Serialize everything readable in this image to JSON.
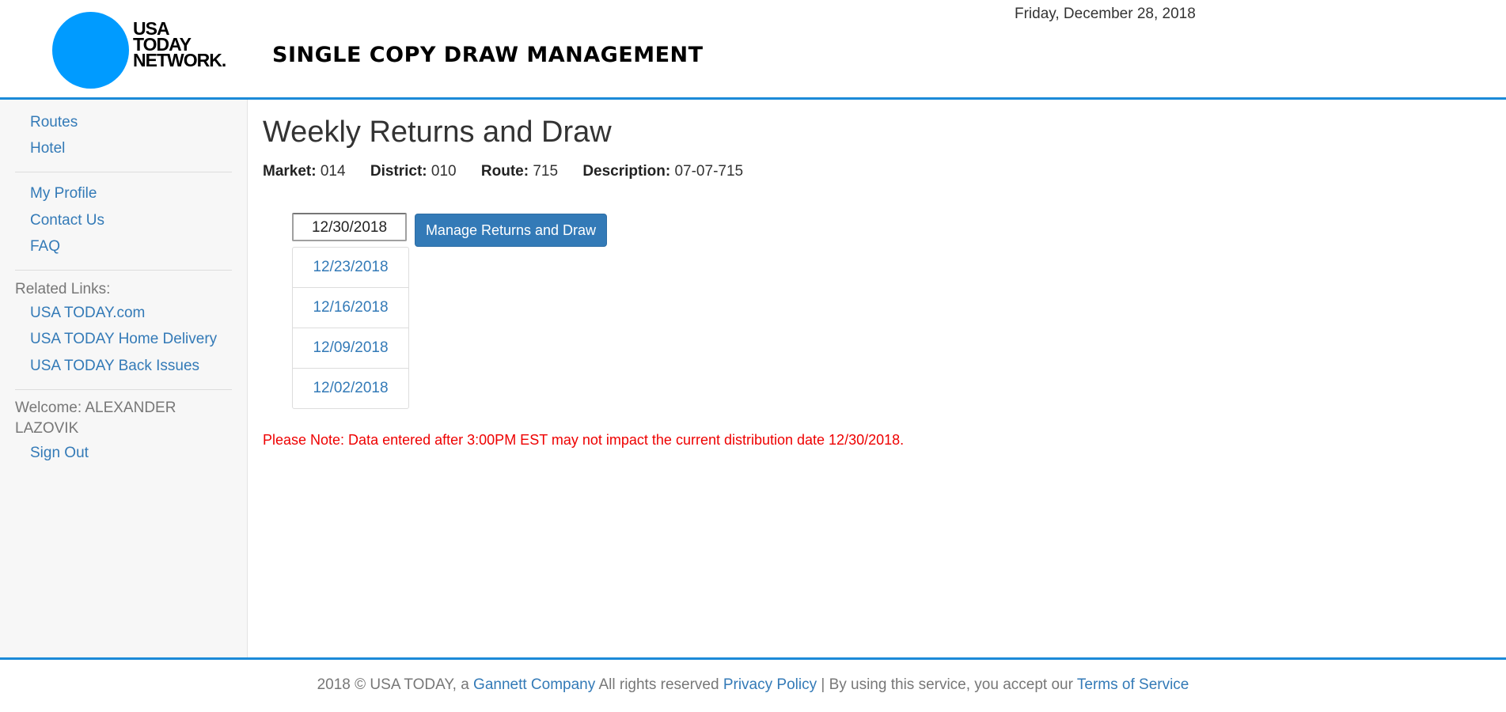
{
  "header": {
    "logo_lines": [
      "USA",
      "TODAY",
      "NETWORK."
    ],
    "app_title": "SINGLE COPY DRAW MANAGEMENT",
    "date": "Friday, December 28, 2018",
    "brand_color": "#009bff"
  },
  "sidebar": {
    "nav": [
      {
        "label": "Routes"
      },
      {
        "label": "Hotel"
      }
    ],
    "account": [
      {
        "label": "My Profile"
      },
      {
        "label": "Contact Us"
      },
      {
        "label": "FAQ"
      }
    ],
    "related_heading": "Related Links:",
    "related": [
      {
        "label": "USA TODAY.com"
      },
      {
        "label": "USA TODAY Home Delivery"
      },
      {
        "label": "USA TODAY Back Issues"
      }
    ],
    "welcome": "Welcome: ALEXANDER LAZOVIK",
    "sign_out": "Sign Out"
  },
  "main": {
    "title": "Weekly Returns and Draw",
    "info": {
      "market_label": "Market:",
      "market": "014",
      "district_label": "District:",
      "district": "010",
      "route_label": "Route:",
      "route": "715",
      "description_label": "Description:",
      "description": "07-07-715"
    },
    "date_input_value": "12/30/2018",
    "manage_button": "Manage Returns and Draw",
    "date_options": [
      "12/23/2018",
      "12/16/2018",
      "12/09/2018",
      "12/02/2018"
    ],
    "note": "Please Note: Data entered after 3:00PM EST may not impact the current distribution date 12/30/2018."
  },
  "footer": {
    "prefix": "2018 © USA TODAY, a ",
    "gannett_link": "Gannett Company",
    "rights": " All rights reserved ",
    "privacy_link": "Privacy Policy",
    "middle": " | By using this service, you accept our ",
    "terms_link": "Terms of Service"
  },
  "colors": {
    "link": "#337ab7",
    "accent_border": "#1b8ad8",
    "note_red": "#ee0000",
    "button_bg": "#337ab7"
  }
}
